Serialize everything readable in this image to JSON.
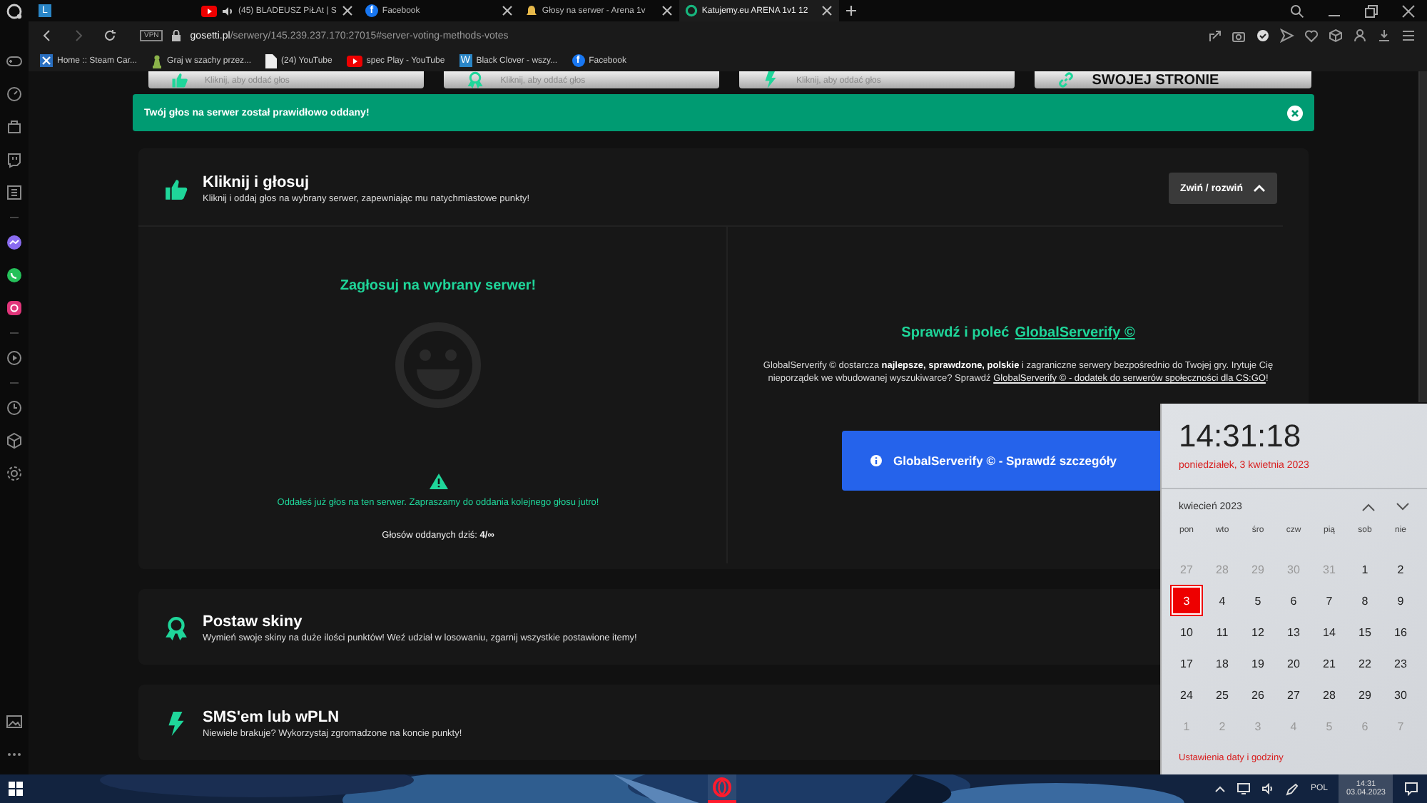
{
  "tabs": [
    {
      "kind": "letter",
      "icon_text": "L",
      "selected": false
    },
    {
      "kind": "youtube",
      "title": "(45) BLADEUSZ PiŁAt | S",
      "audio": true,
      "selected": false
    },
    {
      "kind": "facebook",
      "icon_text": "f",
      "title": "Facebook",
      "selected": false
    },
    {
      "kind": "bell",
      "title": "Głosy na serwer - Arena 1v",
      "selected": false
    },
    {
      "kind": "ring",
      "title": "Katujemy.eu ARENA 1v1 12",
      "selected": true
    }
  ],
  "address_bar": {
    "vpn": "VPN",
    "host": "gosetti.pl",
    "path": "/serwery/145.239.237.170:27015#server-voting-methods-votes"
  },
  "bookmarks": [
    {
      "kind": "steam",
      "label": "Home :: Steam Car..."
    },
    {
      "kind": "chess",
      "label": "Graj w szachy przez..."
    },
    {
      "kind": "page",
      "label": "(24) YouTube"
    },
    {
      "kind": "youtube",
      "label": "spec Play - YouTube"
    },
    {
      "kind": "letter",
      "icon_text": "W",
      "label": "Black Clover - wszy..."
    },
    {
      "kind": "facebook",
      "icon_text": "f",
      "label": "Facebook"
    }
  ],
  "method_cards": [
    {
      "kind": "vote",
      "subtitle": "Kliknij, aby oddać głos"
    },
    {
      "kind": "skins",
      "subtitle": "Kliknij, aby oddać głos"
    },
    {
      "kind": "sms",
      "subtitle": "Kliknij, aby oddać głos"
    },
    {
      "kind": "link",
      "title": "SWOJEJ STRONIE"
    }
  ],
  "alert": {
    "text": "Twój głos na serwer został prawidłowo oddany!"
  },
  "sections": [
    {
      "kind": "vote",
      "title": "Kliknij i głosuj",
      "subtitle": "Kliknij i oddaj głos na wybrany serwer, zapewniając mu natychmiastowe punkty!",
      "toggle": "Zwiń / rozwiń",
      "expanded": true
    },
    {
      "kind": "skins",
      "title": "Postaw skiny",
      "subtitle": "Wymień swoje skiny na duże ilości punktów! Weź udział w losowaniu, zgarnij wszystkie postawione itemy!",
      "expanded": false
    },
    {
      "kind": "sms",
      "title": "SMS'em lub wPLN",
      "subtitle": "Niewiele brakuje? Wykorzystaj zgromadzone na koncie punkty!",
      "expanded": false
    }
  ],
  "vote_panel": {
    "title": "Zagłosuj na wybrany serwer!",
    "notice": "Oddałeś już głos na ten serwer. Zapraszamy do oddania kolejnego głosu jutro!",
    "count": "Głosów oddanych dziś: **4/∞**"
  },
  "promo": {
    "title": "Sprawdź i poleć",
    "title_link": "GlobalServerify ©",
    "text": "GlobalServerify © dostarcza **najlepsze, sprawdzone, polskie** i zagraniczne serwery bezpośrednio do Twojej gry. Irytuje Cię nieporządek we wbudowanej wyszukiwarce? Sprawdź",
    "text_link": "GlobalServerify © - dodatek do serwerów społeczności dla CS:GO",
    "text_end": "!",
    "button": "GlobalServerify © - Sprawdź szczegóły"
  },
  "clock_flyout": {
    "time": "14:31:18",
    "date": "poniedziałek, 3 kwietnia 2023",
    "month": "kwiecień 2023",
    "weekdays": [
      "pon",
      "wto",
      "śro",
      "czw",
      "pią",
      "sob",
      "nie"
    ],
    "days": [
      {
        "label": "27",
        "in_month": false,
        "selected": false
      },
      {
        "label": "28",
        "in_month": false,
        "selected": false
      },
      {
        "label": "29",
        "in_month": false,
        "selected": false
      },
      {
        "label": "30",
        "in_month": false,
        "selected": false
      },
      {
        "label": "31",
        "in_month": false,
        "selected": false
      },
      {
        "label": "1",
        "in_month": true,
        "selected": false
      },
      {
        "label": "2",
        "in_month": true,
        "selected": false
      },
      {
        "label": "3",
        "in_month": true,
        "selected": true
      },
      {
        "label": "4",
        "in_month": true,
        "selected": false
      },
      {
        "label": "5",
        "in_month": true,
        "selected": false
      },
      {
        "label": "6",
        "in_month": true,
        "selected": false
      },
      {
        "label": "7",
        "in_month": true,
        "selected": false
      },
      {
        "label": "8",
        "in_month": true,
        "selected": false
      },
      {
        "label": "9",
        "in_month": true,
        "selected": false
      },
      {
        "label": "10",
        "in_month": true,
        "selected": false
      },
      {
        "label": "11",
        "in_month": true,
        "selected": false
      },
      {
        "label": "12",
        "in_month": true,
        "selected": false
      },
      {
        "label": "13",
        "in_month": true,
        "selected": false
      },
      {
        "label": "14",
        "in_month": true,
        "selected": false
      },
      {
        "label": "15",
        "in_month": true,
        "selected": false
      },
      {
        "label": "16",
        "in_month": true,
        "selected": false
      },
      {
        "label": "17",
        "in_month": true,
        "selected": false
      },
      {
        "label": "18",
        "in_month": true,
        "selected": false
      },
      {
        "label": "19",
        "in_month": true,
        "selected": false
      },
      {
        "label": "20",
        "in_month": true,
        "selected": false
      },
      {
        "label": "21",
        "in_month": true,
        "selected": false
      },
      {
        "label": "22",
        "in_month": true,
        "selected": false
      },
      {
        "label": "23",
        "in_month": true,
        "selected": false
      },
      {
        "label": "24",
        "in_month": true,
        "selected": false
      },
      {
        "label": "25",
        "in_month": true,
        "selected": false
      },
      {
        "label": "26",
        "in_month": true,
        "selected": false
      },
      {
        "label": "27",
        "in_month": true,
        "selected": false
      },
      {
        "label": "28",
        "in_month": true,
        "selected": false
      },
      {
        "label": "29",
        "in_month": true,
        "selected": false
      },
      {
        "label": "30",
        "in_month": true,
        "selected": false
      },
      {
        "label": "1",
        "in_month": false,
        "selected": false
      },
      {
        "label": "2",
        "in_month": false,
        "selected": false
      },
      {
        "label": "3",
        "in_month": false,
        "selected": false
      },
      {
        "label": "4",
        "in_month": false,
        "selected": false
      },
      {
        "label": "5",
        "in_month": false,
        "selected": false
      },
      {
        "label": "6",
        "in_month": false,
        "selected": false
      },
      {
        "label": "7",
        "in_month": false,
        "selected": false
      }
    ],
    "settings_link": "Ustawienia daty i godziny"
  },
  "taskbar": {
    "language": "POL",
    "time": "14:31",
    "date": "03.04.2023"
  }
}
